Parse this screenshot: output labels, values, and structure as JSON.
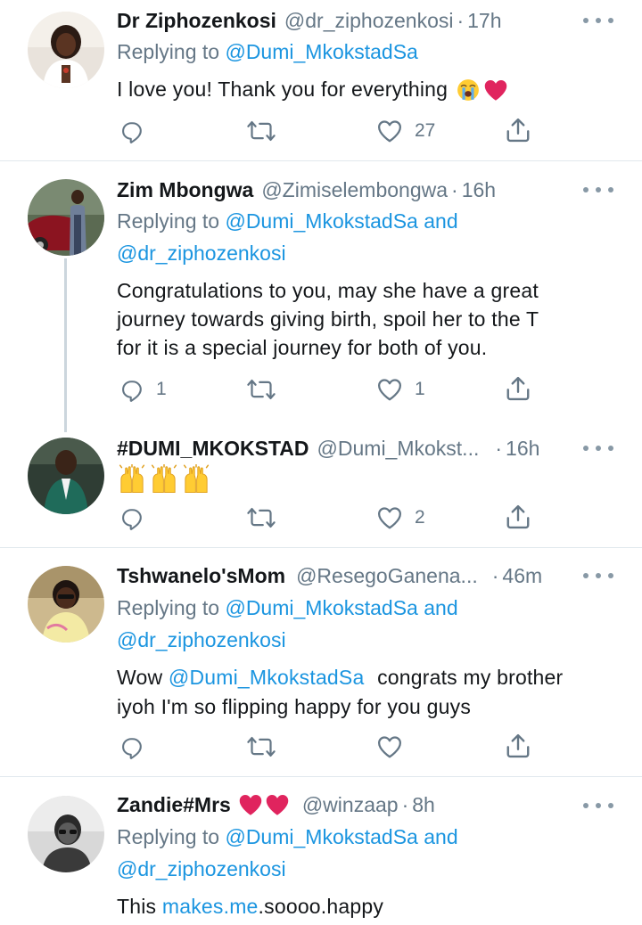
{
  "tweets": [
    {
      "name": "Dr Ziphozenkosi",
      "handle": "@dr_ziphozenkosi",
      "dot": "·",
      "time": "17h",
      "replying_prefix": "Replying to",
      "replying_to": "@Dumi_MkokstadSa",
      "replying_and": "",
      "replying_to_2": "",
      "body": "I love you! Thank you for everything",
      "emoji": [
        "loudly-crying-face",
        "red-heart"
      ],
      "counts": {
        "reply": "",
        "retweet": "",
        "like": "27"
      }
    },
    {
      "name": "Zim Mbongwa",
      "handle": "@Zimiselembongwa",
      "dot": "·",
      "time": "16h",
      "replying_prefix": "Replying to",
      "replying_to": "@Dumi_MkokstadSa",
      "replying_and": "and",
      "replying_to_2": "@dr_ziphozenkosi",
      "body_lines": [
        "Congratulations to you, may she have a great",
        "journey towards giving birth, spoil her to the T",
        "for it is a special journey for both of you."
      ],
      "counts": {
        "reply": "1",
        "retweet": "",
        "like": "1"
      }
    },
    {
      "name": "#DUMI_MKOKSTAD",
      "handle": "@Dumi_Mkokst...",
      "dot": "·",
      "time": "16h",
      "emoji": [
        "raising-hands",
        "raising-hands",
        "raising-hands"
      ],
      "counts": {
        "reply": "",
        "retweet": "",
        "like": "2"
      }
    },
    {
      "name": "Tshwanelo'sMom",
      "handle": "@ResegoGanena...",
      "dot": "·",
      "time": "46m",
      "replying_prefix": "Replying to",
      "replying_to": "@Dumi_MkokstadSa",
      "replying_and": "and",
      "replying_to_2": "@dr_ziphozenkosi",
      "body_line1_prefix": "Wow",
      "body_line1_mention": "@Dumi_MkokstadSa",
      "body_line1_suffix": "congrats my brother",
      "body_line2": "iyoh I'm so flipping happy for you guys",
      "counts": {
        "reply": "",
        "retweet": "",
        "like": ""
      }
    },
    {
      "name": "Zandie#Mrs",
      "name_emoji": [
        "red-heart",
        "red-heart"
      ],
      "handle": "@winzaap",
      "dot": "·",
      "time": "8h",
      "replying_prefix": "Replying to",
      "replying_to": "@Dumi_MkokstadSa",
      "replying_and": "and",
      "replying_to_2": "@dr_ziphozenkosi",
      "body_prefix": "This",
      "body_link": "makes.me",
      "body_suffix": ".soooo.happy"
    }
  ],
  "icons": {
    "reply": "reply-icon",
    "retweet": "retweet-icon",
    "like": "like-icon",
    "share": "share-icon",
    "more": "more-icon"
  },
  "colors": {
    "link": "#1b95e0",
    "muted": "#657786",
    "divider": "#e1e8ed",
    "heart": "#e0245e",
    "emoji_yellow": "#ffcc33"
  }
}
